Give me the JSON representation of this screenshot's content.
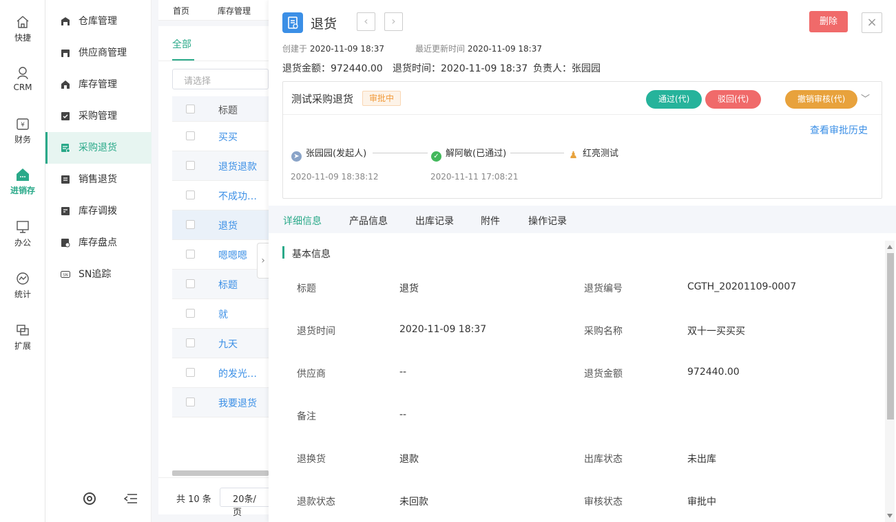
{
  "rail": [
    {
      "label": "快捷",
      "icon": "home-icon"
    },
    {
      "label": "CRM",
      "icon": "person-icon"
    },
    {
      "label": "财务",
      "icon": "finance-icon"
    },
    {
      "label": "进销存",
      "icon": "store-icon",
      "active": true
    },
    {
      "label": "办公",
      "icon": "monitor-icon"
    },
    {
      "label": "统计",
      "icon": "chart-icon"
    },
    {
      "label": "扩展",
      "icon": "extend-icon"
    }
  ],
  "menu": [
    {
      "label": "仓库管理",
      "icon": "warehouse-icon"
    },
    {
      "label": "供应商管理",
      "icon": "supplier-icon"
    },
    {
      "label": "库存管理",
      "icon": "inventory-icon"
    },
    {
      "label": "采购管理",
      "icon": "purchase-icon"
    },
    {
      "label": "采购退货",
      "icon": "purchase-return-icon",
      "active": true
    },
    {
      "label": "销售退货",
      "icon": "sales-return-icon"
    },
    {
      "label": "库存调拨",
      "icon": "transfer-icon"
    },
    {
      "label": "库存盘点",
      "icon": "stocktake-icon"
    },
    {
      "label": "SN追踪",
      "icon": "sn-icon"
    }
  ],
  "breadcrumb": [
    "首页",
    "库存管理"
  ],
  "list": {
    "tab": "全部",
    "select_placeholder": "请选择",
    "header": "标题",
    "rows": [
      "买买",
      "退货退款",
      "不成功…",
      "退货",
      "嗯嗯嗯",
      "标题",
      "就",
      "九天",
      "的发光…",
      "我要退货"
    ],
    "total": "共 10 条",
    "page_size": "20条/页"
  },
  "detail": {
    "title": "退货",
    "delete_label": "删除",
    "created_label": "创建于",
    "created_at": "2020-11-09 18:37",
    "updated_label": "最近更新时间",
    "updated_at": "2020-11-09 18:37",
    "amount_label": "退货金额：",
    "amount": "972440.00",
    "time_label": "退货时间：",
    "time": "2020-11-09 18:37",
    "owner_label": "负责人：",
    "owner": "张园园"
  },
  "approval": {
    "title": "测试采购退货",
    "status": "审批中",
    "pass_label": "通过(代)",
    "reject_label": "驳回(代)",
    "revoke_label": "撤销审核(代)",
    "history_label": "查看审批历史",
    "steps": [
      {
        "label": "张园园(发起人)",
        "time": "2020-11-09 18:38:12"
      },
      {
        "label": "解阿敏(已通过)",
        "time": "2020-11-11 17:08:21"
      },
      {
        "label": "红亮测试",
        "time": ""
      }
    ],
    "colors": {
      "pass": "#26b39b",
      "reject": "#f06a6a",
      "revoke": "#e8a23c"
    }
  },
  "tabs": [
    "详细信息",
    "产品信息",
    "出库记录",
    "附件",
    "操作记录"
  ],
  "section_title": "基本信息",
  "fields": [
    {
      "k": "标题",
      "v": "退货"
    },
    {
      "k": "退货编号",
      "v": "CGTH_20201109-0007"
    },
    {
      "k": "退货时间",
      "v": "2020-11-09 18:37"
    },
    {
      "k": "采购名称",
      "v": "双十一买买买"
    },
    {
      "k": "供应商",
      "v": "--"
    },
    {
      "k": "退货金额",
      "v": "972440.00"
    },
    {
      "k": "备注",
      "v": "--"
    },
    {
      "k": "退换货",
      "v": "退款"
    },
    {
      "k": "出库状态",
      "v": "未出库"
    },
    {
      "k": "退款状态",
      "v": "未回款"
    },
    {
      "k": "审核状态",
      "v": "审批中"
    }
  ],
  "accent": "#2aa989"
}
